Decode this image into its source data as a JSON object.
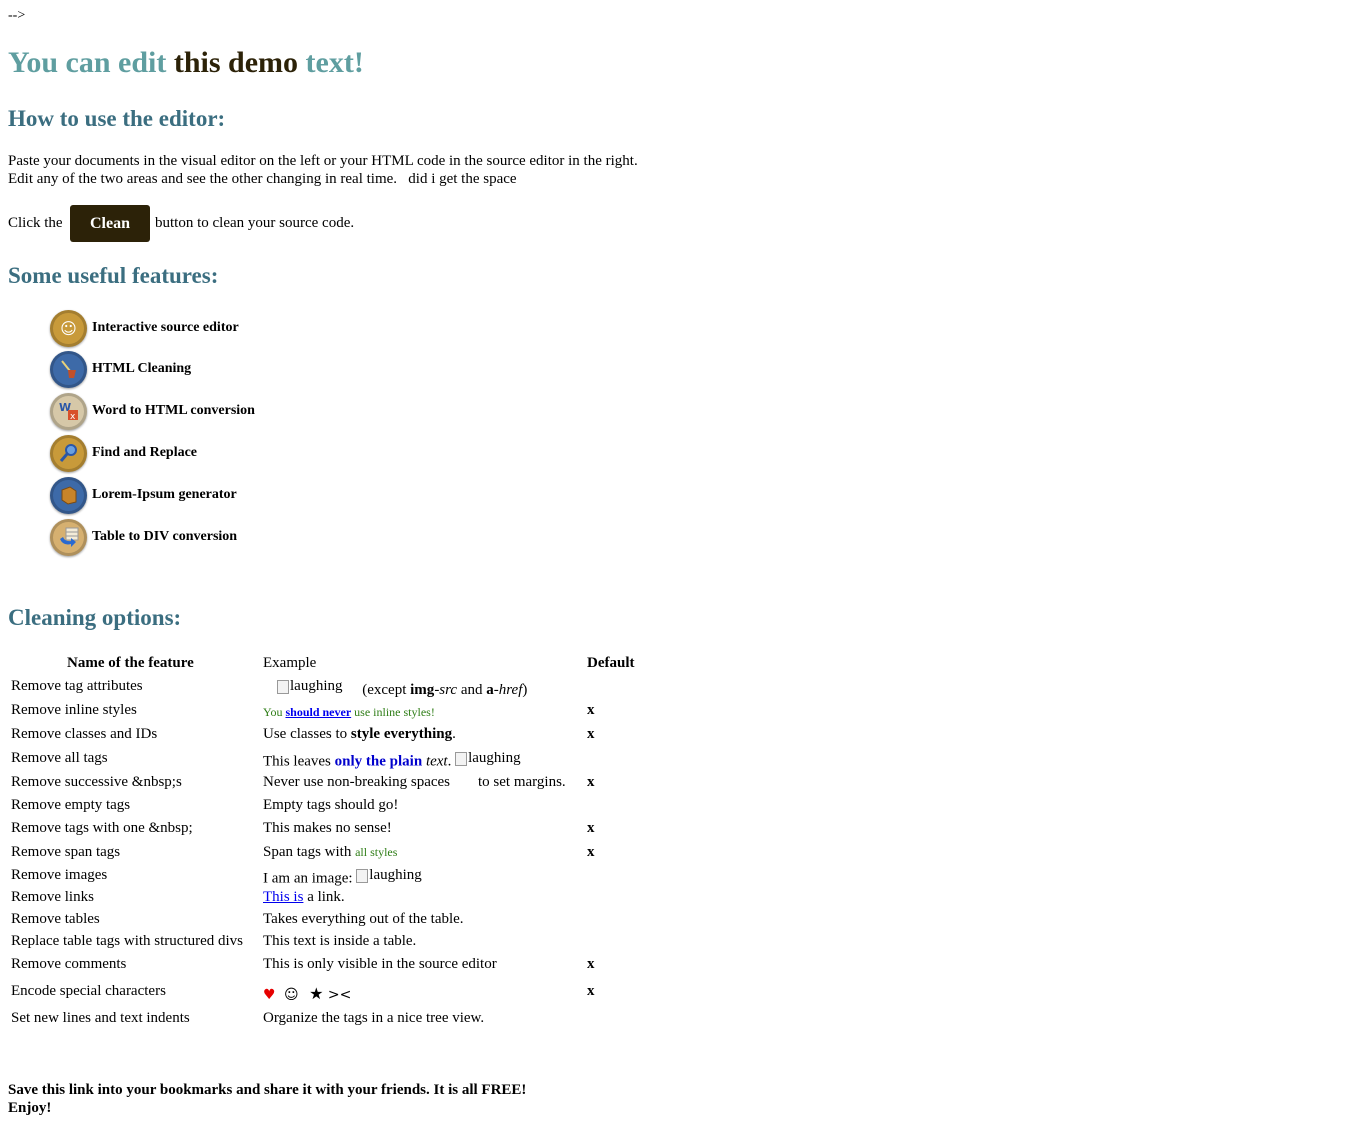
{
  "stray_text": "-->",
  "title": {
    "part1": "You can edit",
    "part2": "this demo",
    "part3": "text!"
  },
  "how_to": {
    "heading": "How to use the editor:",
    "line1": "Paste your documents in the visual editor on the left or your HTML code in the source editor in the right.",
    "line2": "Edit any of the two areas and see the other changing in real time.   did i get the space",
    "click_pre": "Click the",
    "clean_button": "Clean",
    "click_post": "button to clean your source code."
  },
  "features": {
    "heading": "Some useful features:",
    "items": [
      {
        "label": "Interactive source editor",
        "icon": "smiley-icon",
        "color": "#c89a3a"
      },
      {
        "label": "HTML Cleaning",
        "icon": "broom-icon",
        "color": "#3d6aa8"
      },
      {
        "label": "Word to HTML conversion",
        "icon": "word-icon",
        "color": "#d6c8a8"
      },
      {
        "label": "Find and Replace",
        "icon": "magnifier-icon",
        "color": "#c89a3a"
      },
      {
        "label": "Lorem-Ipsum generator",
        "icon": "book-icon",
        "color": "#3d6aa8"
      },
      {
        "label": "Table to DIV conversion",
        "icon": "table-arrow-icon",
        "color": "#d6b070"
      }
    ]
  },
  "cleaning": {
    "heading": "Cleaning options:",
    "col_name": "Name of the feature",
    "col_example": "Example",
    "col_default": "Default",
    "default_mark": "x",
    "rows": [
      {
        "name": "Remove tag attributes",
        "default": false
      },
      {
        "name": "Remove inline styles",
        "default": true
      },
      {
        "name": "Remove classes and IDs",
        "default": true
      },
      {
        "name": "Remove all tags",
        "default": false
      },
      {
        "name": "Remove successive &nbsp;s",
        "default": true
      },
      {
        "name": "Remove empty tags",
        "default": false
      },
      {
        "name": "Remove tags with one &nbsp;",
        "default": true
      },
      {
        "name": "Remove span tags",
        "default": true
      },
      {
        "name": "Remove images",
        "default": false
      },
      {
        "name": "Remove links",
        "default": false
      },
      {
        "name": "Remove tables",
        "default": false
      },
      {
        "name": "Replace table tags with structured divs",
        "default": false
      },
      {
        "name": "Remove comments",
        "default": true
      },
      {
        "name": "Encode special characters",
        "default": true
      },
      {
        "name": "Set new lines and text indents",
        "default": false
      }
    ],
    "examples": {
      "r0": {
        "alt": "laughing",
        "pre": "(except ",
        "b1": "img",
        "i1": "-src",
        "and": " and ",
        "b2": "a",
        "i2": "-href",
        "post": ")"
      },
      "r1": {
        "a": "You ",
        "link": "should never",
        "b": " use inline styles!"
      },
      "r2": {
        "a": "Use classes to ",
        "b": "style everything",
        "c": "."
      },
      "r3": {
        "a": "This leaves ",
        "blue": "only the plain",
        "it": " text",
        "dot": ".",
        "alt": "laughing"
      },
      "r4": {
        "a": "Never use non-breaking spaces",
        "b": "to set margins."
      },
      "r5": "Empty tags should go!",
      "r6": "This makes no sense!",
      "r7": {
        "a": "Span tags with ",
        "green": "all styles"
      },
      "r8": {
        "a": "I am an image: ",
        "alt": "laughing"
      },
      "r9": {
        "link": "This is",
        "b": " a link."
      },
      "r10": "Takes everything out of the table.",
      "r11": "This text is inside a table.",
      "r12": "This is only visible in the source editor",
      "r13": {
        "heart": "♥",
        "smile": "☺",
        "star": "★",
        "gtlt": "><"
      },
      "r14": "Organize the tags in a nice tree view."
    }
  },
  "footer": {
    "line1": "Save this link into your bookmarks and share it with your friends. It is all FREE!",
    "line2": "Enjoy!"
  }
}
